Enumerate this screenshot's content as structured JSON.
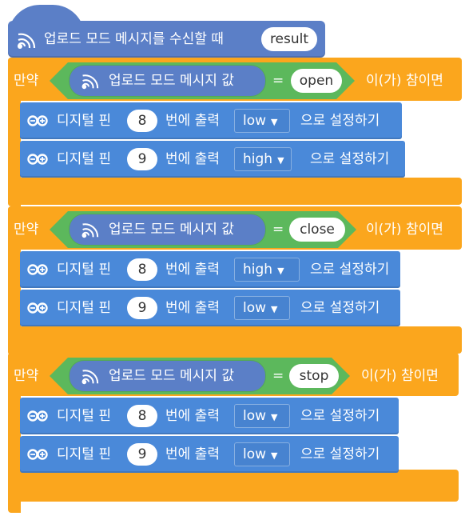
{
  "hat": {
    "label": "업로드 모드 메시지를 수신할 때",
    "param": "result",
    "color": "#5b7fc7"
  },
  "colors": {
    "control": "#fba61d",
    "condition": "#5cb85c",
    "pin_block": "#4a89d9",
    "reporter": "#5b7fc7"
  },
  "ifs": [
    {
      "prefix": "만약",
      "reporter": "업로드 모드 메시지 값",
      "op": "=",
      "value": "open",
      "suffix": "이(가) 참이면",
      "statements": [
        {
          "a": "디지털 핀",
          "pin": "8",
          "b": "번에 출력",
          "level": "low",
          "c": "으로 설정하기"
        },
        {
          "a": "디지털 핀",
          "pin": "9",
          "b": "번에 출력",
          "level": "high",
          "c": "으로 설정하기"
        }
      ]
    },
    {
      "prefix": "만약",
      "reporter": "업로드 모드 메시지 값",
      "op": "=",
      "value": "close",
      "suffix": "이(가) 참이면",
      "statements": [
        {
          "a": "디지털 핀",
          "pin": "8",
          "b": "번에 출력",
          "level": "high",
          "c": "으로 설정하기"
        },
        {
          "a": "디지털 핀",
          "pin": "9",
          "b": "번에 출력",
          "level": "low",
          "c": "으로 설정하기"
        }
      ]
    },
    {
      "prefix": "만약",
      "reporter": "업로드 모드 메시지 값",
      "op": "=",
      "value": "stop",
      "suffix": "이(가) 참이면",
      "statements": [
        {
          "a": "디지털 핀",
          "pin": "8",
          "b": "번에 출력",
          "level": "low",
          "c": "으로 설정하기"
        },
        {
          "a": "디지털 핀",
          "pin": "9",
          "b": "번에 출력",
          "level": "low",
          "c": "으로 설정하기"
        }
      ]
    }
  ],
  "icons": {
    "hat": "upload-signal-icon",
    "reporter": "upload-signal-icon",
    "pin": "arduino-infinity-icon",
    "dropdown": "caret-down-icon"
  }
}
